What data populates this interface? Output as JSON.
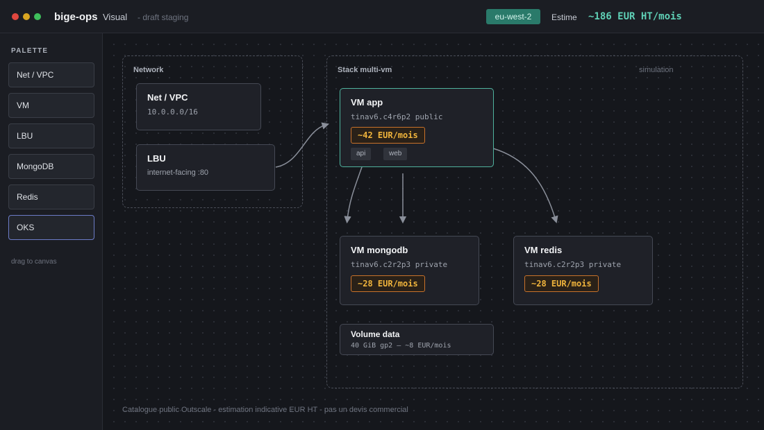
{
  "titlebar": {
    "app_name": "bige-ops",
    "mode": "Visual",
    "subtitle": "- draft staging",
    "region": "eu-west-2",
    "estimate_label": "Estime",
    "estimate_value": "~186 EUR HT/mois"
  },
  "sidebar": {
    "title": "PALETTE",
    "items": [
      {
        "label": "Net / VPC"
      },
      {
        "label": "VM"
      },
      {
        "label": "LBU"
      },
      {
        "label": "MongoDB"
      },
      {
        "label": "Redis"
      },
      {
        "label": "OKS",
        "selected": true
      }
    ],
    "hint": "drag to canvas"
  },
  "canvas": {
    "groups": {
      "network": {
        "label": "Network"
      },
      "stack": {
        "label": "Stack multi-vm",
        "note": "simulation"
      }
    },
    "nodes": {
      "net_vpc": {
        "title": "Net / VPC",
        "sub": "10.0.0.0/16"
      },
      "lbu": {
        "title": "LBU",
        "sub": "internet-facing :80"
      },
      "vm_app": {
        "title": "VM app",
        "sub": "tinav6.c4r6p2 public",
        "cost": "~42 EUR/mois",
        "tags": [
          "api",
          "web"
        ]
      },
      "vm_mongodb": {
        "title": "VM mongodb",
        "sub": "tinav6.c2r2p3 private",
        "cost": "~28 EUR/mois"
      },
      "vm_redis": {
        "title": "VM redis",
        "sub": "tinav6.c2r2p3 private",
        "cost": "~28 EUR/mois"
      },
      "volume": {
        "title": "Volume data",
        "sub": "40 GiB gp2 — ~8 EUR/mois"
      }
    },
    "footer": "Catalogue public Outscale - estimation indicative EUR HT - pas un devis commercial"
  },
  "colors": {
    "accent": "#5fd0b6",
    "region_badge": "#2a7a6a",
    "cost_border": "#c9722a",
    "cost_text": "#f0b43c",
    "selected_border": "#6c7cc8"
  }
}
